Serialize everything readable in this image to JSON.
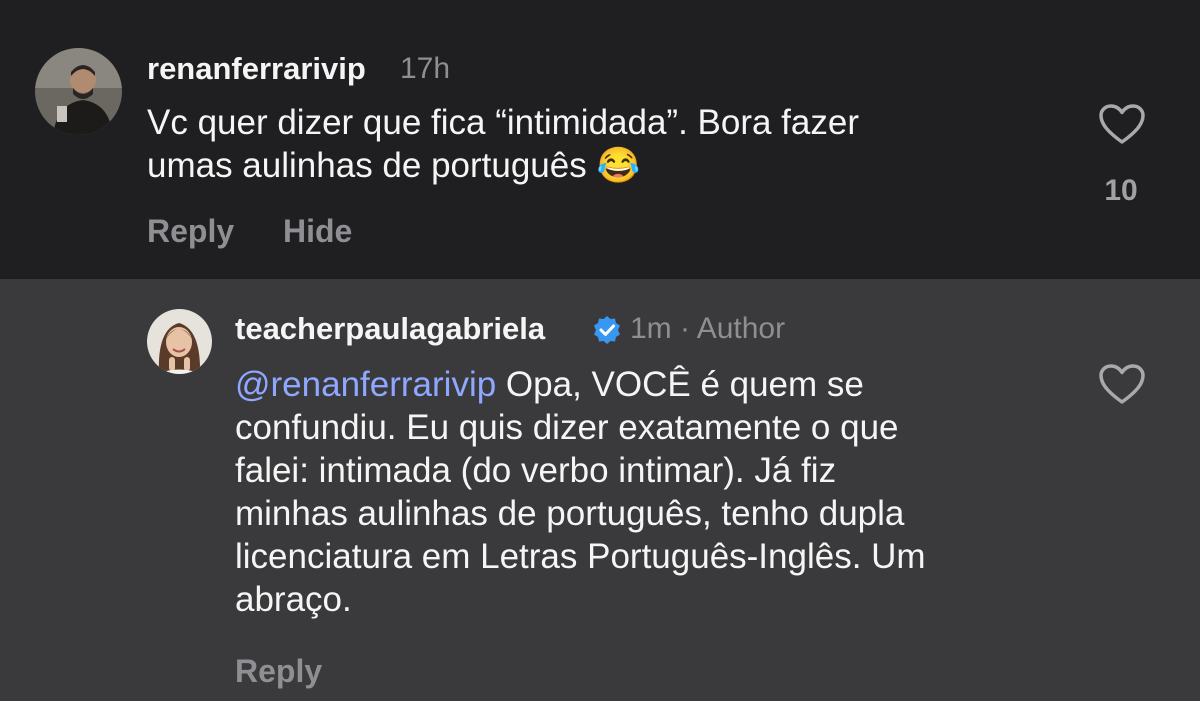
{
  "comments": [
    {
      "username": "renanferrarivip",
      "time": "17h",
      "text": "Vc quer dizer que fica “intimidada”. Bora fazer umas aulinhas de português 😂",
      "line1": "Vc quer dizer que fica “intimidada”. Bora fazer",
      "line2": "umas aulinhas de português",
      "emoji": "😂",
      "like_count": "10",
      "actions": {
        "reply": "Reply",
        "hide": "Hide"
      }
    },
    {
      "username": "teacherpaulagabriela",
      "time": "1m",
      "separator": "·",
      "author_badge": "Author",
      "mention": "@renanferrarivip",
      "line1": "Opa, VOCÊ é quem se",
      "line2": "confundiu. Eu quis dizer exatamente o que",
      "line3": "falei: intimada (do verbo intimar). Já fiz",
      "line4": "minhas aulinhas de português, tenho dupla",
      "line5": "licenciatura em Letras Português-Inglês. Um",
      "line6": "abraço.",
      "actions": {
        "reply": "Reply"
      }
    }
  ],
  "icons": {
    "like": "heart-outline-icon",
    "verified": "verified-badge-icon"
  },
  "colors": {
    "top_background": "#1f1f21",
    "reply_background": "#3a3a3c",
    "mention": "#8fa8ff",
    "verified": "#3897f0",
    "secondary_text": "#8e8e93"
  }
}
